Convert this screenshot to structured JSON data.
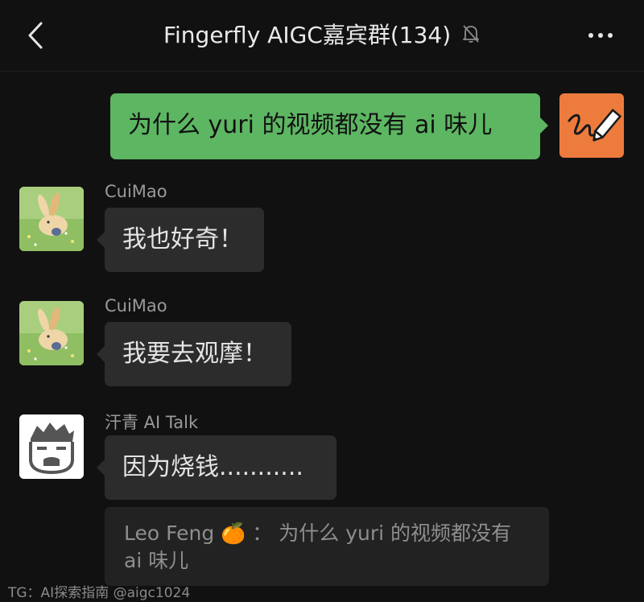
{
  "header": {
    "title": "Fingerfly AIGC嘉宾群(134)",
    "back_icon": "chevron-left-icon",
    "mute_icon": "bell-off-icon",
    "more_icon": "more-dots-icon"
  },
  "messages": [
    {
      "direction": "out",
      "text": "为什么 yuri 的视频都没有 ai 味儿",
      "avatar_icon": "pen-scribble-avatar"
    },
    {
      "direction": "in",
      "sender": "CuiMao",
      "text": "我也好奇！",
      "avatar_icon": "rabbit-illustration-avatar"
    },
    {
      "direction": "in",
      "sender": "CuiMao",
      "text": "我要去观摩！",
      "avatar_icon": "rabbit-illustration-avatar"
    },
    {
      "direction": "in",
      "sender": "汗青 AI Talk",
      "text": "因为烧钱...........",
      "avatar_icon": "bearded-face-avatar"
    }
  ],
  "quote": {
    "author": "Leo Feng",
    "emoji": "🍊",
    "separator": "：",
    "text": "为什么 yuri 的视频都没有 ai 味儿"
  },
  "watermark": "TG：AI探索指南 @aigc1024",
  "colors": {
    "background": "#111111",
    "outgoing_bubble": "#5db662",
    "incoming_bubble": "#2c2c2c",
    "quote_bg": "#222222",
    "self_avatar_bg": "#ee7b3e"
  }
}
